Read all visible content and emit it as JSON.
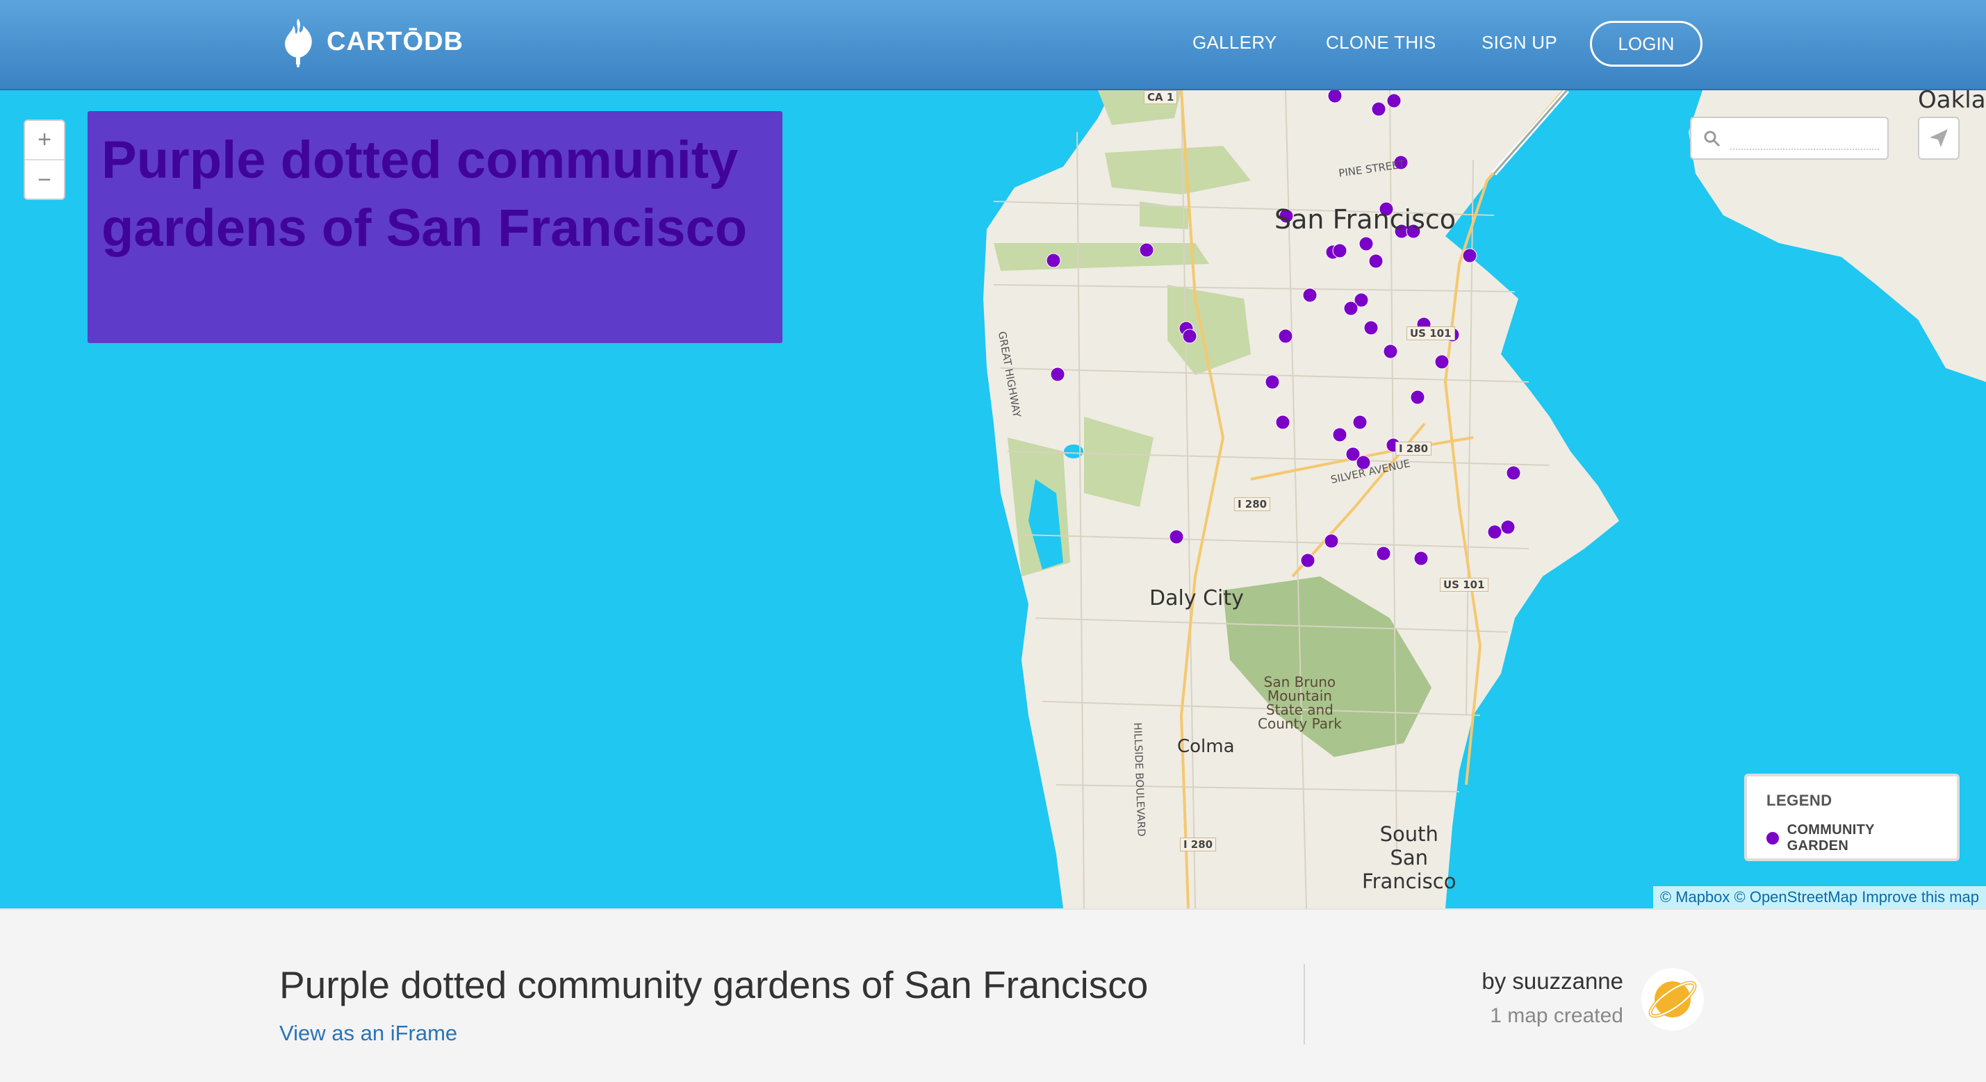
{
  "header": {
    "logo_text": "CARTŌDB",
    "nav": {
      "gallery": "GALLERY",
      "clone": "CLONE THIS",
      "signup": "SIGN UP",
      "login": "LOGIN"
    }
  },
  "map": {
    "title": "Purple dotted community gardens of San Francisco",
    "zoom_in": "+",
    "zoom_out": "−",
    "search": {
      "placeholder": ""
    },
    "labels": {
      "oakland": "Oakla",
      "san_francisco": "San Francisco",
      "daly_city": "Daly City",
      "colma": "Colma",
      "south_sf": "South\nSan\nFrancisco",
      "park": "San Bruno\nMountain\nState and\nCounty Park",
      "ca1": "CA 1",
      "pine": "PINE STREET",
      "great_hwy": "GREAT HIGHWAY",
      "us101a": "US 101",
      "i280a": "I 280",
      "silver": "SILVER AVENUE",
      "i280b": "I 280",
      "us101b": "US 101",
      "hillside": "HILLSIDE BOULEVARD",
      "i280c": "I 280"
    },
    "legend": {
      "title": "LEGEND",
      "items": [
        {
          "label": "COMMUNITY GARDEN",
          "color": "#7b00c8"
        }
      ]
    },
    "attribution": "© Mapbox © OpenStreetMap Improve this map",
    "colors": {
      "water": "#1fc7f1",
      "land": "#efece4",
      "park": "#c7d9a6",
      "marker": "#7b00c8",
      "title_bg": "#5f3bc9",
      "title_text": "#41049a"
    }
  },
  "footer": {
    "title": "Purple dotted community gardens of San Francisco",
    "iframe_link": "View as an iFrame",
    "author": "by suuzzanne",
    "maps_created": "1 map created"
  }
}
